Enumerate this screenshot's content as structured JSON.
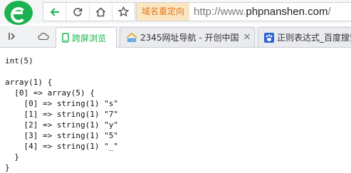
{
  "browser": {
    "redirect_label": "域名重定向",
    "url_scheme": "http://www.",
    "url_host": "phpnanshen.com",
    "url_rest": "/"
  },
  "tabs": [
    {
      "label": "跨屏浏览",
      "active": true,
      "icon": "phone-icon"
    },
    {
      "label": "2345网址导航 - 开创中国",
      "active": false,
      "icon": "2345-favicon"
    },
    {
      "label": "正则表达式_百度搜索",
      "active": false,
      "icon": "baidu-paw-icon"
    }
  ],
  "output_lines": [
    "int(5)",
    "",
    "array(1) {",
    "  [0] => array(5) {",
    "    [0] => string(1) \"s\"",
    "    [1] => string(1) \"7\"",
    "    [2] => string(1) \"y\"",
    "    [3] => string(1) \"5\"",
    "    [4] => string(1) \"_\"",
    "  }",
    "}"
  ],
  "colors": {
    "brand_green": "#1cb24f",
    "redirect_bg": "#fbe6c2",
    "redirect_text": "#e0781a",
    "active_tab_text": "#1cb24f"
  }
}
